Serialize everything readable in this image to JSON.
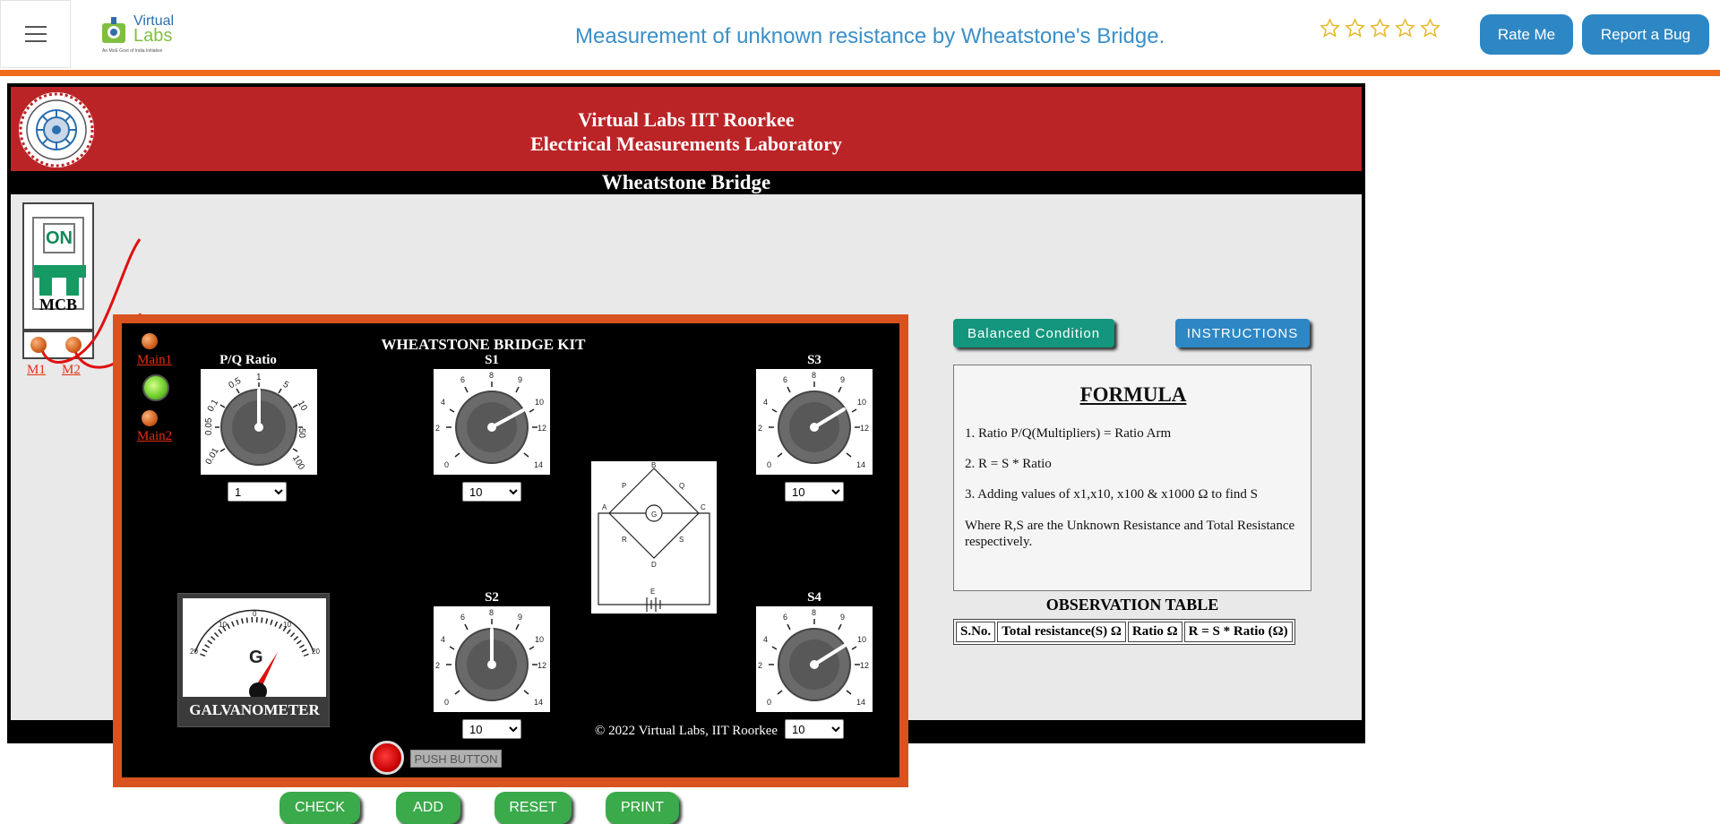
{
  "navbar": {
    "logo_line1": "Virtual",
    "logo_line2": "Labs",
    "logo_tagline": "An MoE Govt of India Initiative",
    "title": "Measurement of unknown resistance by Wheatstone's Bridge.",
    "rating_stars": 5,
    "rate_label": "Rate Me",
    "bug_label": "Report a Bug",
    "accent_color": "#ef6c1a",
    "button_color": "#2d87c5"
  },
  "header": {
    "line1": "Virtual Labs IIT Roorkee",
    "line2": "Electrical Measurements Laboratory",
    "subtitle": "Wheatstone Bridge",
    "bg_color": "#bb2427"
  },
  "mcb": {
    "state": "ON",
    "label": "MCB"
  },
  "terminals": {
    "main1": "Main1",
    "main2": "Main2",
    "m1": "M1",
    "m2": "M2"
  },
  "kit": {
    "title": "WHEATSTONE BRIDGE KIT",
    "pq": {
      "label": "P/Q Ratio",
      "value": "1",
      "options": [
        "1"
      ],
      "scale": [
        "0.1",
        "0.5",
        "1",
        "5",
        "10",
        "50",
        "100",
        "0.01",
        "0.05"
      ]
    },
    "s1": {
      "label": "S1",
      "value": "10",
      "options": [
        "10"
      ]
    },
    "s2": {
      "label": "S2",
      "value": "10",
      "options": [
        "10"
      ]
    },
    "s3": {
      "label": "S3",
      "value": "10",
      "options": [
        "10"
      ]
    },
    "s4": {
      "label": "S4",
      "value": "10",
      "options": [
        "10"
      ]
    },
    "dial_scale": [
      "0",
      "2",
      "4",
      "6",
      "8",
      "9",
      "10",
      "12",
      "14"
    ],
    "galvanometer_label": "GALVANOMETER",
    "galvanometer_letter": "G",
    "galvanometer_scale": [
      "20",
      "10",
      "0",
      "10",
      "20"
    ],
    "push_button_label": "PUSH BUTTON"
  },
  "panel": {
    "balanced_label": "Balanced Condition",
    "instructions_label": "INSTRUCTIONS",
    "formula_title": "FORMULA",
    "formula_lines": [
      "1. Ratio P/Q(Multipliers) = Ratio Arm",
      "2. R = S * Ratio",
      "3. Adding values of x1,x10, x100 & x1000 Ω to find S",
      "Where R,S are the Unknown Resistance and Total Resistance respectively."
    ],
    "observation_title": "OBSERVATION TABLE",
    "table_headers": [
      "S.No.",
      "Total resistance(S) Ω",
      "Ratio Ω",
      "R = S * Ratio (Ω)"
    ]
  },
  "actions": {
    "check": "CHECK",
    "add": "ADD",
    "reset": "RESET",
    "print": "PRINT"
  },
  "footer": "© 2022 Virtual Labs, IIT Roorkee"
}
